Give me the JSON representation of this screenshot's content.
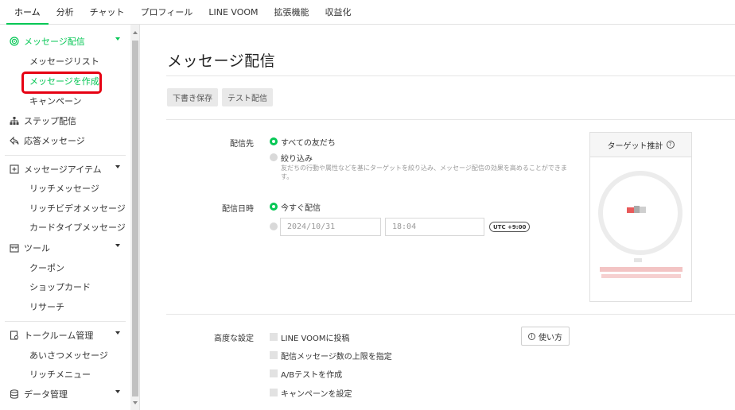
{
  "top_nav": {
    "tabs": [
      {
        "label": "ホーム"
      },
      {
        "label": "分析"
      },
      {
        "label": "チャット"
      },
      {
        "label": "プロフィール"
      },
      {
        "label": "LINE VOOM"
      },
      {
        "label": "拡張機能"
      },
      {
        "label": "収益化"
      }
    ],
    "active_index": 0
  },
  "sidebar": {
    "message_delivery": "メッセージ配信",
    "message_list": "メッセージリスト",
    "create_message": "メッセージを作成",
    "campaign": "キャンペーン",
    "step_delivery": "ステップ配信",
    "auto_reply": "応答メッセージ",
    "message_items": "メッセージアイテム",
    "rich_message": "リッチメッセージ",
    "rich_video_message": "リッチビデオメッセージ",
    "card_type_message": "カードタイプメッセージ",
    "tools": "ツール",
    "coupon": "クーポン",
    "shop_card": "ショップカード",
    "research": "リサーチ",
    "talk_room": "トークルーム管理",
    "greeting_message": "あいさつメッセージ",
    "rich_menu": "リッチメニュー",
    "data_management": "データ管理"
  },
  "main": {
    "title": "メッセージ配信",
    "save_draft": "下書き保存",
    "test_delivery": "テスト配信",
    "recipients_label": "配信先",
    "all_friends": "すべての友だち",
    "filter": "絞り込み",
    "filter_note": "友だちの行動や属性などを基にターゲットを絞り込み、メッセージ配信の効果を高めることができます。",
    "datetime_label": "配信日時",
    "send_now": "今すぐ配信",
    "date_placeholder": "2024/10/31",
    "time_placeholder": "18:04",
    "timezone": "UTC +9:00",
    "target_estimate": "ターゲット推計",
    "advanced_label": "高度な設定",
    "post_voom": "LINE VOOMに投稿",
    "limit_count": "配信メッセージ数の上限を指定",
    "ab_test": "A/Bテストを作成",
    "set_campaign": "キャンペーンを設定",
    "how_to_use": "使い方"
  },
  "colors": {
    "accent_green": "#06c755",
    "highlight_red": "#e60012"
  }
}
